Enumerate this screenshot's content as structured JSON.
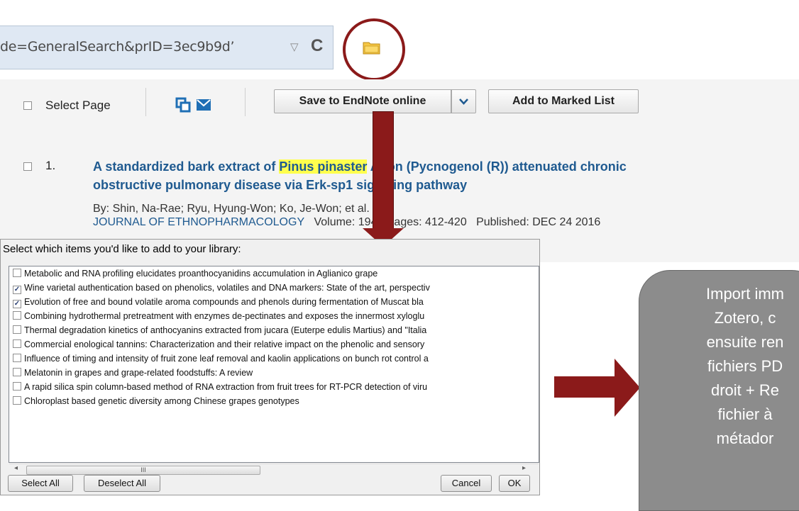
{
  "browser": {
    "url_fragment": "de=GeneralSearch&prID=3ec9b9d’",
    "dropdown_glyph": "▽",
    "reload_glyph": "C",
    "folder_icon": "folder-icon"
  },
  "wos_toolbar": {
    "select_page_label": "Select Page",
    "save_button_label": "Save to EndNote online",
    "add_marked_label": "Add to Marked List",
    "dropdown_glyph": "⌄"
  },
  "result": {
    "number": "1.",
    "title_line1_before": "A standardized bark extract of ",
    "title_highlight": "Pinus pinaster",
    "title_line1_after": " Aiton (Pycnogenol (R)) attenuated chronic",
    "title_line2": "obstructive pulmonary disease via Erk-sp1 signaling pathway",
    "authors": "By: Shin, Na-Rae; Ryu, Hyung-Won; Ko, Je-Won; et al.",
    "journal": "JOURNAL OF ETHNOPHARMACOLOGY",
    "volume_label": "Volume: 194",
    "pages_label": "Pages: 412-420",
    "published_label": "Published: DEC 24 2016"
  },
  "dialog": {
    "title": "Select which items you'd like to add to your library:",
    "items": [
      {
        "label": "Metabolic and RNA profiling elucidates proanthocyanidins accumulation in Aglianico grape",
        "checked": false
      },
      {
        "label": "Wine varietal authentication based on phenolics, volatiles and DNA markers: State of the art, perspectiv",
        "checked": true
      },
      {
        "label": "Evolution of free and bound volatile aroma compounds and phenols during fermentation of Muscat bla",
        "checked": true
      },
      {
        "label": "Combining hydrothermal pretreatment with enzymes de-pectinates and exposes the innermost xyloglu",
        "checked": false
      },
      {
        "label": "Thermal degradation kinetics of anthocyanins extracted from jucara (Euterpe edulis Martius) and \"Italia",
        "checked": false
      },
      {
        "label": "Commercial enological tannins: Characterization and their relative impact on the phenolic and sensory",
        "checked": false
      },
      {
        "label": "Influence of timing and intensity of fruit zone leaf removal and kaolin applications on bunch rot control a",
        "checked": false
      },
      {
        "label": "Melatonin in grapes and grape-related foodstuffs: A review",
        "checked": false
      },
      {
        "label": "A rapid silica spin column-based method of RNA extraction from fruit trees for RT-PCR detection of viru",
        "checked": false
      },
      {
        "label": "Chloroplast based genetic diversity among Chinese grapes genotypes",
        "checked": false
      }
    ],
    "scroll_left": "◂",
    "scroll_right": "▸",
    "scroll_thumb_grip": "III",
    "select_all_label": "Select All",
    "deselect_all_label": "Deselect All",
    "cancel_label": "Cancel",
    "ok_label": "OK"
  },
  "callout": {
    "text": "Import imm\nZotero, c\nensuite ren\nfichiers PD\ndroit + Re\nfichier à\nmétador"
  },
  "colors": {
    "arrow": "#8b1a1a",
    "link_blue": "#1f5a90",
    "highlight": "#ffff4d",
    "callout_bg": "#8c8c8c"
  }
}
